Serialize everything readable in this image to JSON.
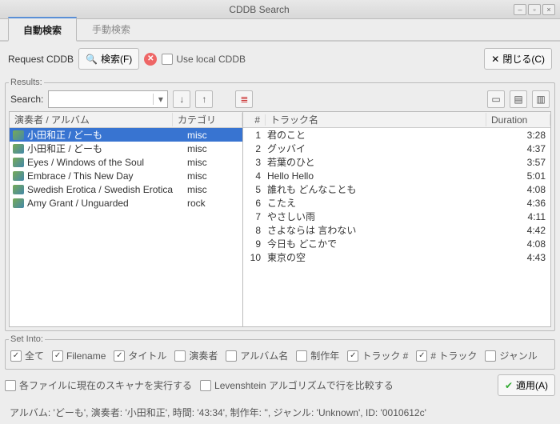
{
  "window": {
    "title": "CDDB Search"
  },
  "tabs": {
    "auto": "自動検索",
    "manual": "手動検索"
  },
  "toolbar": {
    "request": "Request CDDB",
    "search": "検索(F)",
    "use_local": "Use local CDDB",
    "close": "閉じる(C)"
  },
  "results": {
    "legend": "Results:",
    "search_label": "Search:",
    "search_value": "",
    "col_artist": "演奏者 / アルバム",
    "col_category": "カテゴリ",
    "col_num": "#",
    "col_track": "トラック名",
    "col_duration": "Duration",
    "albums": [
      {
        "label": "小田和正 / どーも",
        "category": "misc",
        "selected": true
      },
      {
        "label": "小田和正 / どーも",
        "category": "misc",
        "selected": false
      },
      {
        "label": "Eyes / Windows of the Soul",
        "category": "misc",
        "selected": false
      },
      {
        "label": "Embrace / This New Day",
        "category": "misc",
        "selected": false
      },
      {
        "label": "Swedish Erotica / Swedish Erotica",
        "category": "misc",
        "selected": false
      },
      {
        "label": "Amy Grant / Unguarded",
        "category": "rock",
        "selected": false
      }
    ],
    "tracks": [
      {
        "n": "1",
        "title": "君のこと",
        "dur": "3:28"
      },
      {
        "n": "2",
        "title": "グッバイ",
        "dur": "4:37"
      },
      {
        "n": "3",
        "title": "若葉のひと",
        "dur": "3:57"
      },
      {
        "n": "4",
        "title": "Hello Hello",
        "dur": "5:01"
      },
      {
        "n": "5",
        "title": "誰れも どんなことも",
        "dur": "4:08"
      },
      {
        "n": "6",
        "title": "こたえ",
        "dur": "4:36"
      },
      {
        "n": "7",
        "title": "やさしい雨",
        "dur": "4:11"
      },
      {
        "n": "8",
        "title": "さよならは 言わない",
        "dur": "4:42"
      },
      {
        "n": "9",
        "title": "今日も どこかで",
        "dur": "4:08"
      },
      {
        "n": "10",
        "title": "東京の空",
        "dur": "4:43"
      }
    ]
  },
  "setinto": {
    "legend": "Set Into:",
    "all": "全て",
    "filename": "Filename",
    "title": "タイトル",
    "artist": "演奏者",
    "album": "アルバム名",
    "year": "制作年",
    "trackno": "トラック #",
    "ntracks": "# トラック",
    "genre": "ジャンル",
    "run_scanner": "各ファイルに現在のスキャナを実行する",
    "levenshtein": "Levenshtein アルゴリズムで行を比較する",
    "apply": "適用(A)"
  },
  "status": "アルバム: 'どーも', 演奏者: '小田和正', 時間: '43:34', 制作年: '', ジャンル: 'Unknown', ID: '0010612c'"
}
